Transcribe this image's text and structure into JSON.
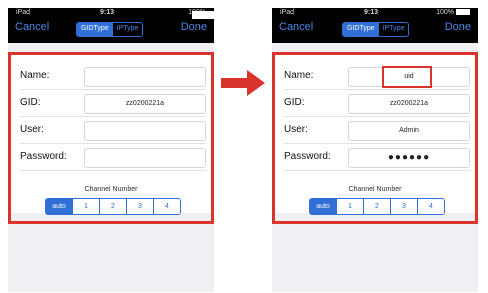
{
  "left": {
    "status": {
      "carrier": "iPad",
      "time": "9:13",
      "battery": "100%"
    },
    "nav": {
      "left": "Cancel",
      "right": "Done",
      "segments": [
        "GIDType",
        "IPType"
      ]
    },
    "fields": {
      "name": "",
      "gid": "zz0200221a",
      "user": "",
      "password": ""
    },
    "labels": {
      "name": "Name:",
      "gid": "GID:",
      "user": "User:",
      "password": "Password:"
    },
    "channel": {
      "title": "Channel Number",
      "options": [
        "auto",
        "1",
        "2",
        "3",
        "4"
      ]
    }
  },
  "right": {
    "status": {
      "carrier": "iPad",
      "time": "9:13",
      "battery": "100%"
    },
    "nav": {
      "left": "Cancel",
      "right": "Done",
      "segments": [
        "GIDType",
        "IPType"
      ]
    },
    "fields": {
      "name": "uid",
      "gid": "zz0200221a",
      "user": "Admin",
      "password": "●●●●●●"
    },
    "labels": {
      "name": "Name:",
      "gid": "GID:",
      "user": "User:",
      "password": "Password:"
    },
    "channel": {
      "title": "Channel Number",
      "options": [
        "auto",
        "1",
        "2",
        "3",
        "4"
      ]
    }
  },
  "colors": {
    "accent": "#2f6fd6",
    "highlight": "#d9342b",
    "arrow": "#d9342b"
  }
}
